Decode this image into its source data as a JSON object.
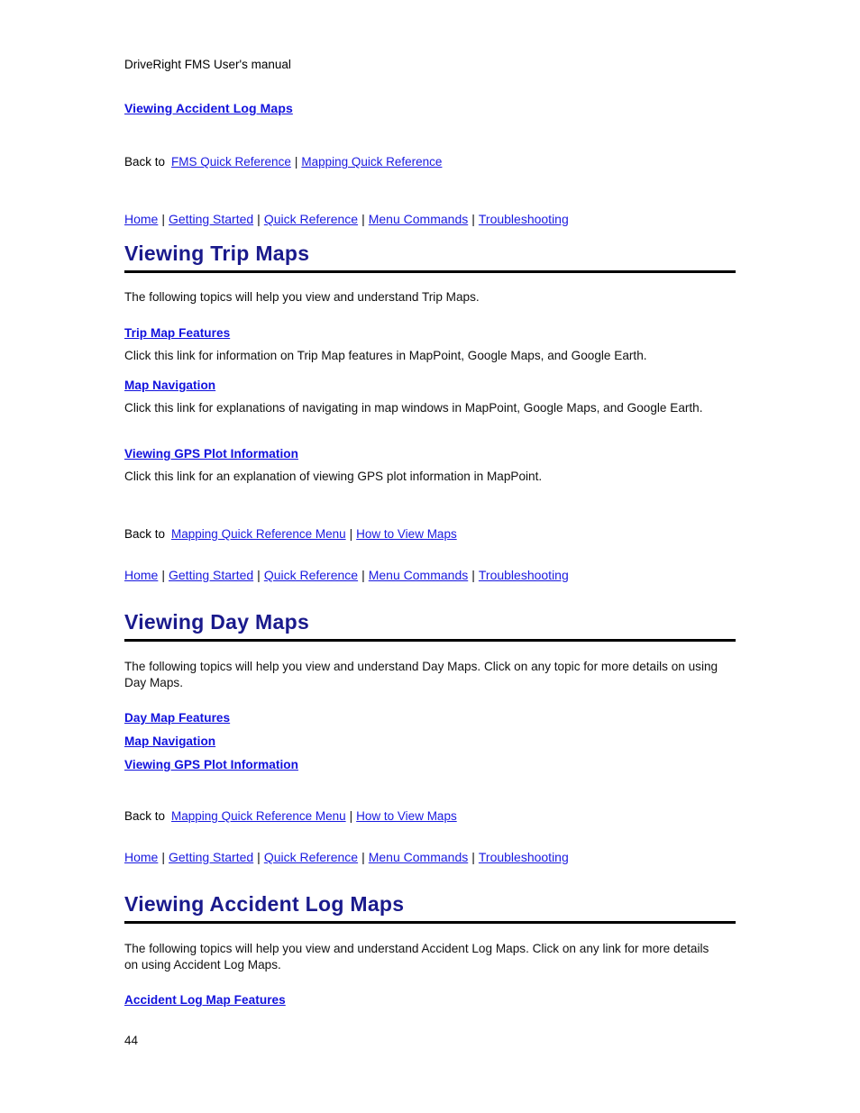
{
  "document": {
    "running_head": "DriveRight FMS User's manual",
    "page_number": "44",
    "heading_color": "#1a1a8c",
    "link_color": "#1a1ae0",
    "rule_color": "#000000"
  },
  "top": {
    "title_link": "Viewing Accident Log Maps",
    "back_to": {
      "label": "Back to",
      "links": [
        "FMS Quick Reference",
        "Mapping Quick Reference"
      ],
      "separator": "|"
    }
  },
  "nav": {
    "separator": "|",
    "items": [
      "Home",
      "Getting Started",
      "Quick Reference",
      "Menu Commands",
      "Troubleshooting"
    ]
  },
  "sections": [
    {
      "heading": "Viewing Trip Maps",
      "intro": "The following topics will help you view and understand Trip Maps.",
      "topics": [
        {
          "link": "Trip Map Features",
          "description": "Click this link for information on Trip Map features in MapPoint, Google Maps, and Google Earth."
        },
        {
          "link": "Map Navigation",
          "description": "Click this link for explanations of navigating in map windows in MapPoint, Google Maps, and Google Earth."
        },
        {
          "link": "Viewing GPS Plot Information",
          "description": "Click this link for an explanation of viewing GPS plot information in MapPoint."
        }
      ],
      "back_to": {
        "label": "Back to",
        "links": [
          "Mapping Quick Reference Menu",
          "How to View Maps"
        ],
        "separator": "|"
      }
    },
    {
      "heading": "Viewing Day Maps",
      "intro": "The following topics will help you view and understand Day Maps. Click on any topic for more details on using Day Maps.",
      "topics": [
        {
          "link": "Day Map Features",
          "description": ""
        },
        {
          "link": "Map Navigation",
          "description": ""
        },
        {
          "link": "Viewing GPS Plot Information",
          "description": ""
        }
      ],
      "back_to": {
        "label": "Back to",
        "links": [
          "Mapping Quick Reference Menu",
          "How to View Maps"
        ],
        "separator": "|"
      }
    },
    {
      "heading": "Viewing Accident Log Maps",
      "intro": "The following topics will help you view and understand Accident Log Maps. Click on any link for more details on using Accident Log Maps.",
      "topics": [
        {
          "link": "Accident Log Map Features",
          "description": ""
        }
      ]
    }
  ]
}
